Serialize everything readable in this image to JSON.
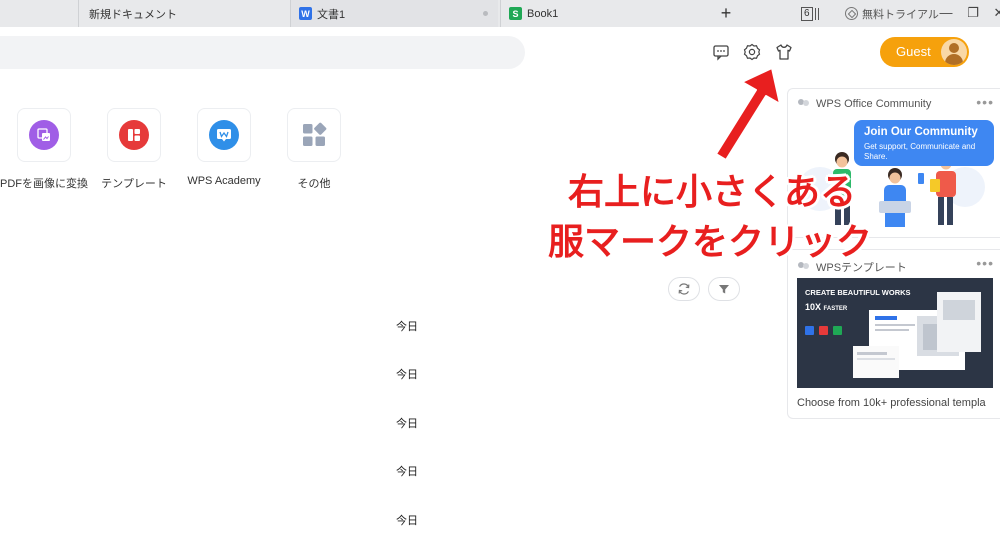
{
  "tabs": {
    "new_doc": "新規ドキュメント",
    "doc1": "文書1",
    "book1": "Book1",
    "add": "+",
    "count": "6",
    "trial": "無料トライアル"
  },
  "window": {
    "minimize": "—",
    "restore": "❐",
    "close": "✕"
  },
  "header": {
    "icons": [
      "feedback-icon",
      "settings-icon",
      "skin-icon"
    ],
    "guest_label": "Guest",
    "accent": "#f6a10c"
  },
  "quick_actions": [
    {
      "label": "PDFを画像に変換",
      "icon": "pdf-to-image-icon",
      "color": "#a05ee6"
    },
    {
      "label": "テンプレート",
      "icon": "template-icon",
      "color": "#e63a3a"
    },
    {
      "label": "WPS Academy",
      "icon": "wps-academy-icon",
      "color": "#2f8fe8"
    },
    {
      "label": "その他",
      "icon": "more-apps-icon",
      "color": "#9aa5b8"
    }
  ],
  "file_list": {
    "rows": [
      "今日",
      "今日",
      "今日",
      "今日",
      "今日"
    ]
  },
  "side_panel": {
    "community": {
      "title": "WPS Office Community",
      "more": "•••",
      "banner_title": "Join Our Community",
      "banner_sub": "Get support, Communicate and Share."
    },
    "template": {
      "title": "WPSテンプレート",
      "more": "•••",
      "image_line1": "CREATE BEAUTIFUL WORKS",
      "image_line2": "10X",
      "image_line2_suffix": "FASTER",
      "caption": "Choose from 10k+ professional templa"
    }
  },
  "annotation": {
    "line1": "右上に小さくある",
    "line2": "服マークをクリック",
    "color": "#e81f1f"
  }
}
